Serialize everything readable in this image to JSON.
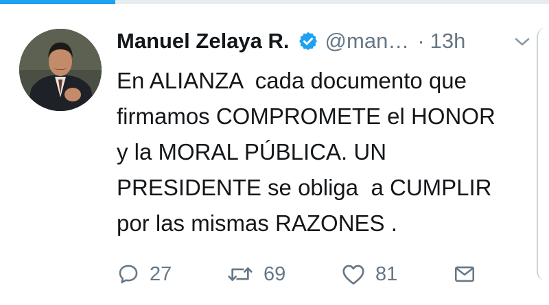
{
  "progress": {
    "fraction": 0.21,
    "color": "#1da1f2"
  },
  "tweet": {
    "author_name": "Manuel Zelaya R.",
    "handle": "@man…",
    "separator": "·",
    "time": "13h",
    "verified_icon": "verified-badge-icon",
    "text": "En ALIANZA  cada documento que\nfirmamos COMPROMETE el HONOR\ny la MORAL PÚBLICA. UN\nPRESIDENTE se obliga  a CUMPLIR\npor las mismas RAZONES ."
  },
  "actions": {
    "reply": {
      "icon": "reply-icon",
      "count": "27"
    },
    "retweet": {
      "icon": "retweet-icon",
      "count": "69"
    },
    "like": {
      "icon": "heart-icon",
      "count": "81"
    },
    "message": {
      "icon": "envelope-icon"
    }
  },
  "colors": {
    "accent": "#1da1f2",
    "muted": "#657786",
    "text": "#14171a"
  }
}
